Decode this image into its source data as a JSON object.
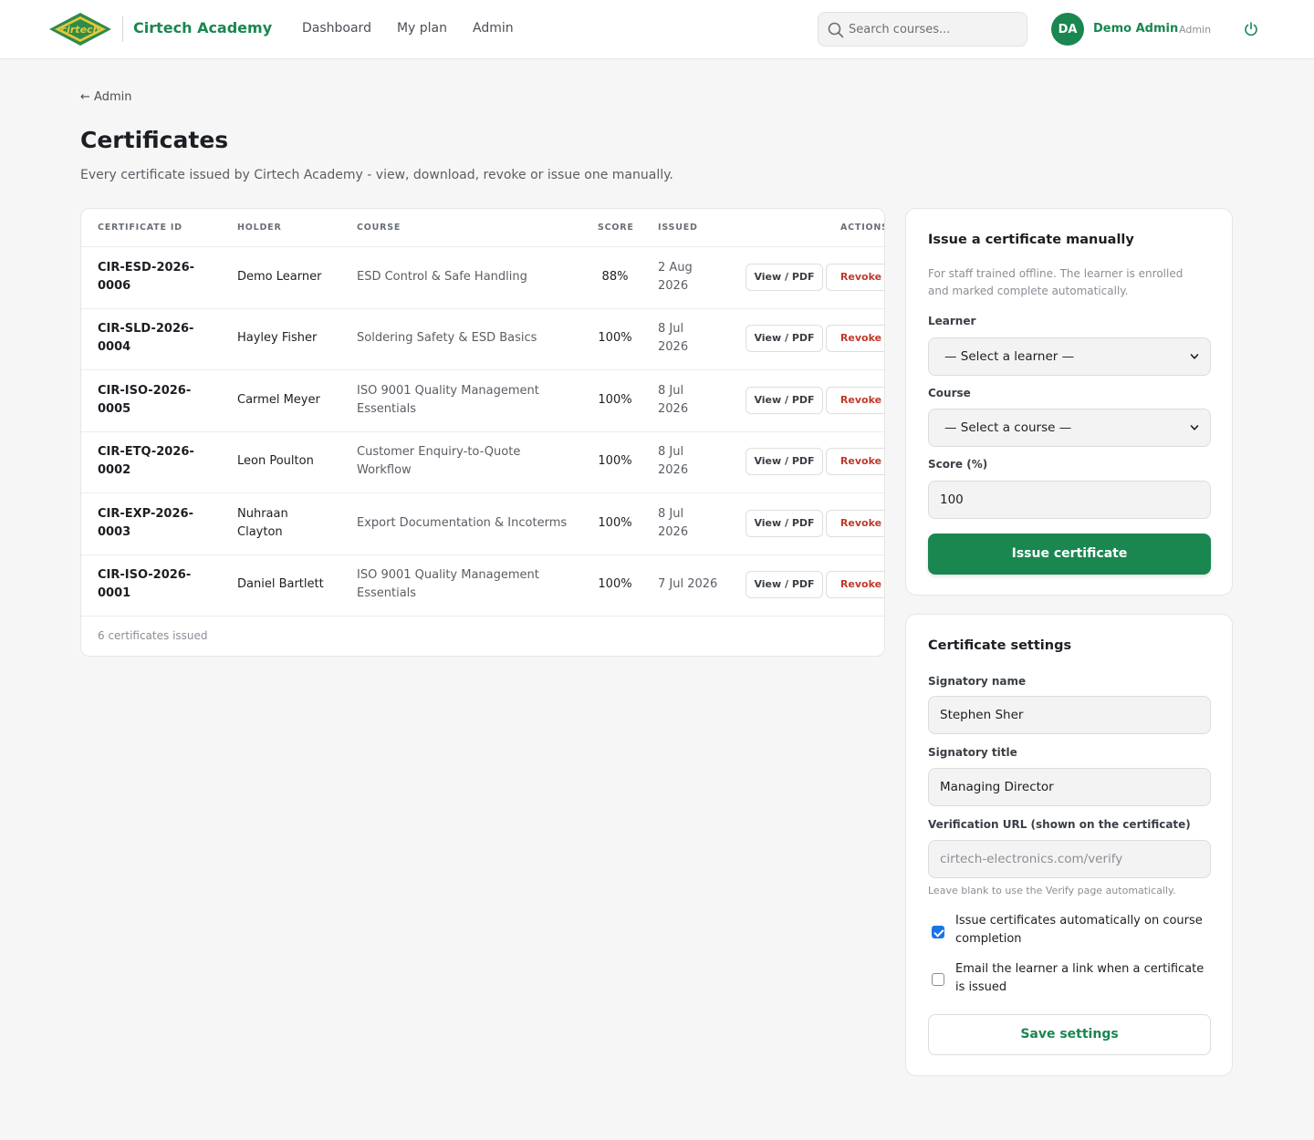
{
  "header": {
    "brand": "Cirtech Academy",
    "logo_text": "cirtech",
    "nav": [
      "Dashboard",
      "My plan",
      "Admin"
    ],
    "search_placeholder": "Search courses...",
    "avatar_initials": "DA",
    "user_name": "Demo Admin",
    "user_role": "Admin"
  },
  "page": {
    "back_link": "← Admin",
    "title": "Certificates",
    "subtitle": "Every certificate issued by Cirtech Academy - view, download, revoke or issue one manually."
  },
  "table": {
    "columns": [
      "Certificate ID",
      "Holder",
      "Course",
      "Score",
      "Issued",
      "Actions"
    ],
    "rows": [
      {
        "id_line1": "CIR-ESD-2026-",
        "id_line2": "0006",
        "holder_line1": "Demo Learner",
        "holder_line2": "",
        "course_line1": "ESD Control & Safe Handling",
        "course_line2": "",
        "score": "88%",
        "issued_line1": "2 Aug",
        "issued_line2": "2026"
      },
      {
        "id_line1": "CIR-SLD-2026-",
        "id_line2": "0004",
        "holder_line1": "Hayley Fisher",
        "holder_line2": "",
        "course_line1": "Soldering Safety & ESD Basics",
        "course_line2": "",
        "score": "100%",
        "issued_line1": "8 Jul",
        "issued_line2": "2026"
      },
      {
        "id_line1": "CIR-ISO-2026-",
        "id_line2": "0005",
        "holder_line1": "Carmel Meyer",
        "holder_line2": "",
        "course_line1": "ISO 9001 Quality Management",
        "course_line2": "Essentials",
        "score": "100%",
        "issued_line1": "8 Jul",
        "issued_line2": "2026"
      },
      {
        "id_line1": "CIR-ETQ-2026-",
        "id_line2": "0002",
        "holder_line1": "Leon Poulton",
        "holder_line2": "",
        "course_line1": "Customer Enquiry-to-Quote",
        "course_line2": "Workflow",
        "score": "100%",
        "issued_line1": "8 Jul",
        "issued_line2": "2026"
      },
      {
        "id_line1": "CIR-EXP-2026-",
        "id_line2": "0003",
        "holder_line1": "Nuhraan",
        "holder_line2": "Clayton",
        "course_line1": "Export Documentation & Incoterms",
        "course_line2": "",
        "score": "100%",
        "issued_line1": "8 Jul",
        "issued_line2": "2026"
      },
      {
        "id_line1": "CIR-ISO-2026-",
        "id_line2": "0001",
        "holder_line1": "Daniel Bartlett",
        "holder_line2": "",
        "course_line1": "ISO 9001 Quality Management",
        "course_line2": "Essentials",
        "score": "100%",
        "issued_line1": "7 Jul 2026",
        "issued_line2": ""
      }
    ],
    "view_label": "View / PDF",
    "revoke_label": "Revoke",
    "footer": "6 certificates issued"
  },
  "issue_card": {
    "title": "Issue a certificate manually",
    "hint": "For staff trained offline. The learner is enrolled and marked complete automatically.",
    "learner_label": "Learner",
    "learner_value": "— Select a learner —",
    "course_label": "Course",
    "course_value": "— Select a course —",
    "score_label": "Score (%)",
    "score_value": "100",
    "submit_label": "Issue certificate"
  },
  "settings_card": {
    "title": "Certificate settings",
    "signatory_name_label": "Signatory name",
    "signatory_name_value": "Stephen Sher",
    "signatory_title_label": "Signatory title",
    "signatory_title_value": "Managing Director",
    "verify_url_label": "Verification URL (shown on the certificate)",
    "verify_url_placeholder": "cirtech-electronics.com/verify",
    "verify_url_hint": "Leave blank to use the Verify page automatically.",
    "auto_issue_label": "Issue certificates automatically on course completion",
    "auto_issue_checked": true,
    "email_label": "Email the learner a link when a certificate is issued",
    "email_checked": false,
    "save_label": "Save settings"
  },
  "colors": {
    "brand_green": "#1a8650",
    "revoke_red": "#c0392b",
    "logo_yellow": "#e3c83c"
  }
}
